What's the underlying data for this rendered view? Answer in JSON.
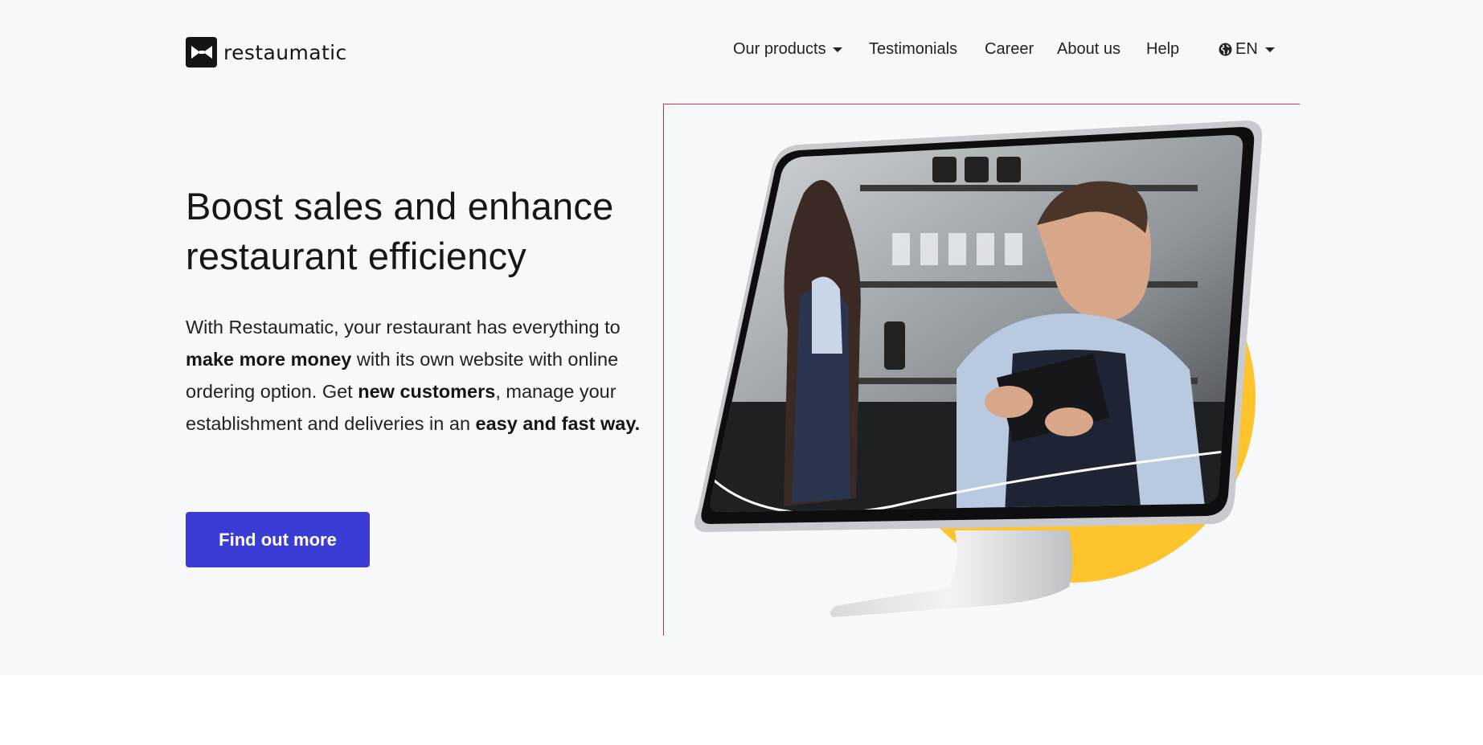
{
  "header": {
    "brand": "restaumatic",
    "nav": [
      {
        "label": "Our products",
        "dropdown": true
      },
      {
        "label": "Testimonials"
      },
      {
        "label": "Career"
      },
      {
        "label": "About us"
      },
      {
        "label": "Help"
      }
    ],
    "language": {
      "label": "EN",
      "icon": "globe-icon"
    }
  },
  "hero": {
    "headline_line1": "Boost sales and enhance",
    "headline_line2": "restaurant efficiency",
    "paragraph": [
      {
        "text": "With Restaumatic, your restaurant has everything to ",
        "bold": false
      },
      {
        "text": "make more money",
        "bold": true
      },
      {
        "text": " with its own website with online ordering option. Get ",
        "bold": false
      },
      {
        "text": "new customers",
        "bold": true
      },
      {
        "text": ", manage your establishment and deliveries in an ",
        "bold": false
      },
      {
        "text": "easy and fast way.",
        "bold": true
      }
    ],
    "cta_label": "Find out more"
  },
  "colors": {
    "accent": "#3b3bd6",
    "circle": "#fdc42e",
    "frame_line": "#e03040",
    "hero_bg": "#f7f8fa"
  }
}
